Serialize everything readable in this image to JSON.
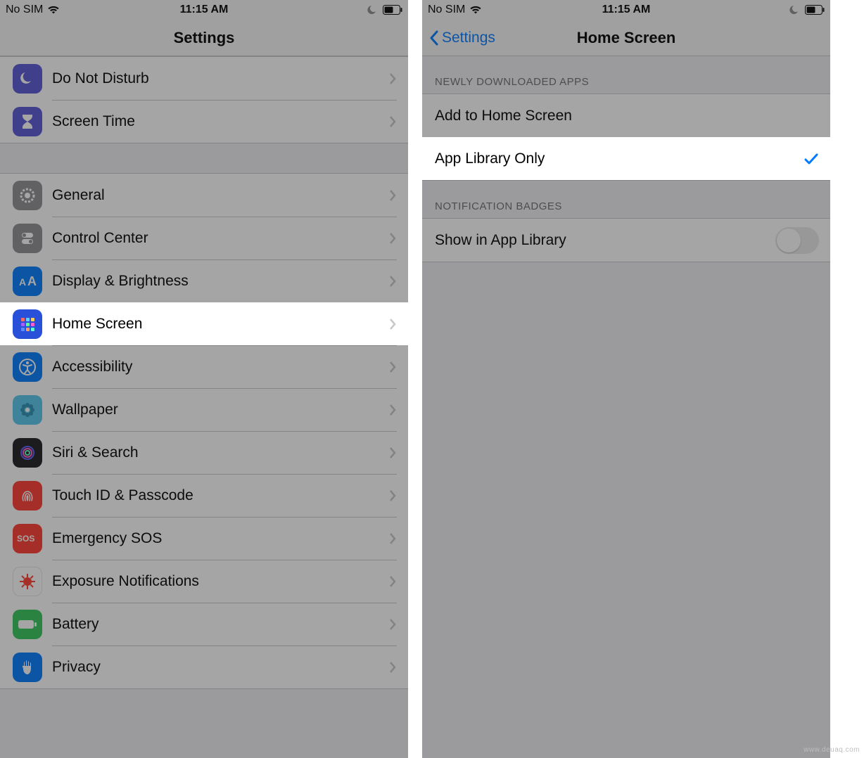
{
  "status": {
    "carrier": "No SIM",
    "time": "11:15 AM"
  },
  "left": {
    "title": "Settings",
    "rows": [
      {
        "label": "Do Not Disturb",
        "icon": "moon",
        "bg": "#5856d6"
      },
      {
        "label": "Screen Time",
        "icon": "hourglass",
        "bg": "#5856d6"
      }
    ],
    "group2": [
      {
        "label": "General",
        "icon": "gear",
        "bg": "#8e8e93"
      },
      {
        "label": "Control Center",
        "icon": "switches",
        "bg": "#8e8e93"
      },
      {
        "label": "Display & Brightness",
        "icon": "aa",
        "bg": "#007aff"
      },
      {
        "label": "Home Screen",
        "icon": "grid",
        "bg": "#2850d8",
        "highlight": true
      },
      {
        "label": "Accessibility",
        "icon": "person",
        "bg": "#007aff"
      },
      {
        "label": "Wallpaper",
        "icon": "flower",
        "bg": "#54c7ec"
      },
      {
        "label": "Siri & Search",
        "icon": "siri",
        "bg": "#1c1c1e"
      },
      {
        "label": "Touch ID & Passcode",
        "icon": "fingerprint",
        "bg": "#ff3b30"
      },
      {
        "label": "Emergency SOS",
        "icon": "sos",
        "bg": "#ff3b30"
      },
      {
        "label": "Exposure Notifications",
        "icon": "virus",
        "bg": "#ffffff"
      },
      {
        "label": "Battery",
        "icon": "battery",
        "bg": "#34c759"
      },
      {
        "label": "Privacy",
        "icon": "hand",
        "bg": "#007aff"
      }
    ]
  },
  "right": {
    "back": "Settings",
    "title": "Home Screen",
    "section1": "Newly Downloaded Apps",
    "options": [
      {
        "label": "Add to Home Screen",
        "checked": false
      },
      {
        "label": "App Library Only",
        "checked": true,
        "highlight": true
      }
    ],
    "section2": "Notification Badges",
    "toggle": {
      "label": "Show in App Library",
      "on": false
    }
  },
  "watermark": "www.deuaq.com"
}
